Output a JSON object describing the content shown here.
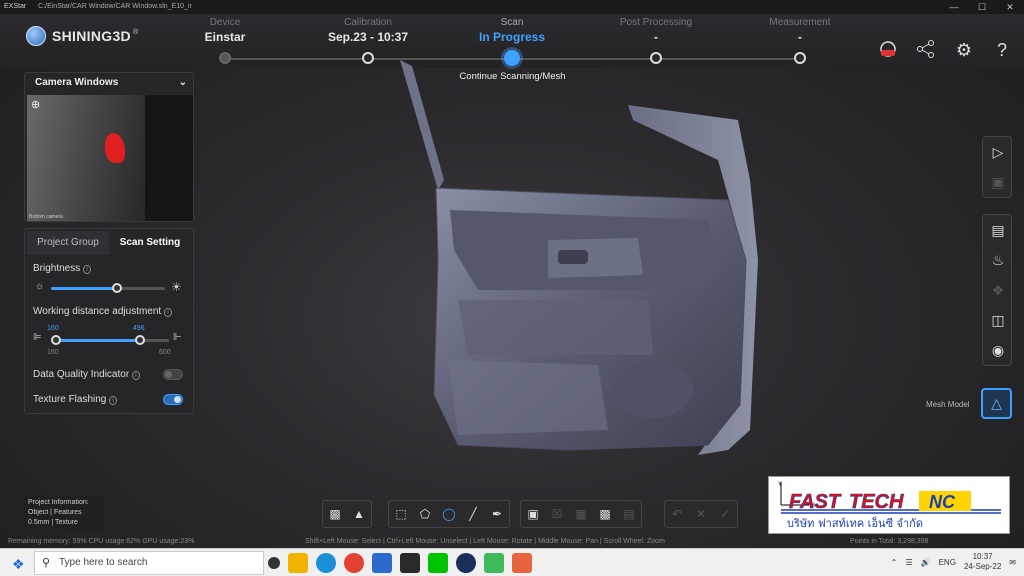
{
  "window": {
    "app_name": "EXStar",
    "path": "C:/EinStar/CAR Window/CAR Window.sln_E10_ir",
    "minimize": "—",
    "maximize": "☐",
    "close": "✕"
  },
  "logo": {
    "text": "SHINING3D",
    "mark": "®"
  },
  "steps": [
    {
      "name": "Device",
      "value": "Einstar"
    },
    {
      "name": "Calibration",
      "value": "Sep.23 - 10:37"
    },
    {
      "name": "Scan",
      "value": "In Progress"
    },
    {
      "name": "Post Processing",
      "value": "-"
    },
    {
      "name": "Measurement",
      "value": "-"
    }
  ],
  "scan_subtitle": "Continue Scanning/Mesh",
  "top_icons": [
    "record-icon",
    "share-icon",
    "settings-icon",
    "help-icon"
  ],
  "camera": {
    "title": "Camera Windows",
    "view_label": "Bottom camera"
  },
  "settings": {
    "tabs": [
      "Project Group",
      "Scan Setting"
    ],
    "brightness_label": "Brightness",
    "brightness_level": 0.58,
    "wd_label": "Working distance adjustment",
    "wd_low": "160",
    "wd_high": "496",
    "wd_min": "160",
    "wd_max": "600",
    "dqi_label": "Data Quality Indicator",
    "dqi_on": false,
    "texture_label": "Texture Flashing",
    "texture_on": true
  },
  "mesh_model_label": "Mesh Model",
  "project_info": {
    "title": "Project Information:",
    "line1": "Object | Features",
    "line2": "0.5mm | Texture"
  },
  "status": {
    "left": "Remaining memory: 59% CPU usage:62%  GPU usage:23%",
    "center": "Shift+Left Mouse: Select | Ctrl+Left Mouse: Unselect | Left Mouse: Rotate | Middle Mouse: Pan | Scroll Wheel: Zoom",
    "right": "Points in Total: 3,298,398"
  },
  "brand": {
    "name_a": "FAST",
    "name_b": "TECH",
    "name_c": "NC",
    "thai": "บริษัท ฟาสท์เทค เอ็นซี จำกัด"
  },
  "taskbar": {
    "search_placeholder": "Type here to search",
    "lang": "ENG",
    "time": "10:37",
    "date": "24-Sep-22"
  }
}
